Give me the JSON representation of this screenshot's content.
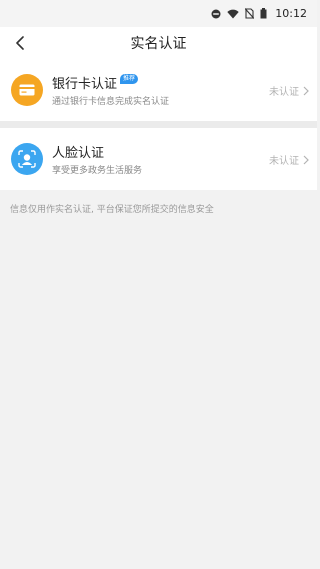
{
  "status_bar": {
    "time": "10:12",
    "icons": [
      "do-not-disturb-icon",
      "wifi-icon",
      "no-sim-icon",
      "battery-icon"
    ]
  },
  "nav": {
    "title": "实名认证",
    "back_icon": "chevron-left-icon"
  },
  "methods": [
    {
      "title": "银行卡认证",
      "badge": "推荐",
      "subtitle": "通过银行卡信息完成实名认证",
      "status": "未认证",
      "icon": "bank-card-icon",
      "color": "#f5a623"
    },
    {
      "title": "人脸认证",
      "badge": "",
      "subtitle": "享受更多政务生活服务",
      "status": "未认证",
      "icon": "face-recognition-icon",
      "color": "#3ba6f0"
    }
  ],
  "footer_note": "信息仅用作实名认证, 平台保证您所提交的信息安全"
}
